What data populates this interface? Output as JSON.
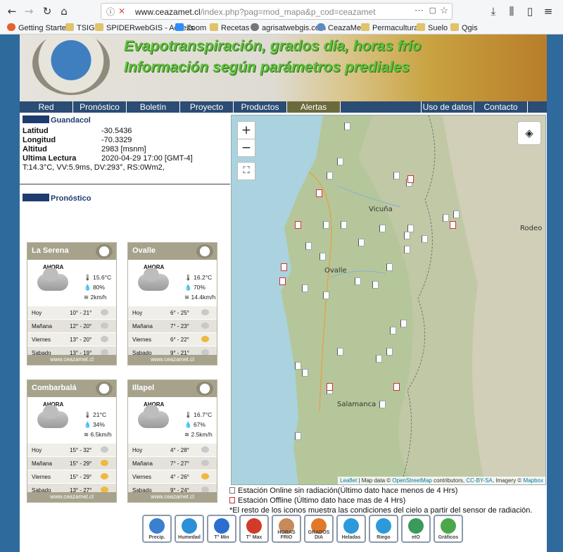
{
  "browser": {
    "url_prefix": "www.ceazamet.cl",
    "url_rest": "/index.php?pag=mod_mapa&p_cod=ceazamet",
    "bookmarks": [
      "Getting Started",
      "TSIG",
      "SPIDERwebGIS - Access",
      "Zoom",
      "Recetas",
      "agrisatwebgis.com",
      "CeazaMet",
      "Permacultura",
      "Suelo",
      "Qgis"
    ]
  },
  "banner": {
    "line1": "Evapotranspiración, grados día, horas frío",
    "line2": "Información según parámetros prediales"
  },
  "menu": [
    "Red",
    "Pronóstico",
    "Boletín",
    "Proyecto",
    "Productos",
    "Alertas",
    "Uso de datos",
    "Contacto"
  ],
  "station": {
    "name": "Guandacol",
    "fields": [
      {
        "k": "Latitud",
        "v": "-30.5436"
      },
      {
        "k": "Longitud",
        "v": "-70.3329"
      },
      {
        "k": "Altitud",
        "v": "2983 [msnm]"
      },
      {
        "k": "Ultima Lectura",
        "v": "2020-04-29 17:00 [GMT-4]"
      }
    ],
    "summary": "T:14.3°C, VV:5.9ms, DV:293°, RS:0Wm2,"
  },
  "forecast": {
    "title": "Pronóstico",
    "now_label": "AHORA",
    "footer": "www.ceazamet.cl",
    "cards": [
      {
        "city": "La Serena",
        "temp": "15.6°C",
        "hum": "80%",
        "wind": "2km/h",
        "days": [
          {
            "d": "Hoy",
            "t": "10° - 21°",
            "w": "pc"
          },
          {
            "d": "Mañana",
            "t": "12° - 20°",
            "w": "pc"
          },
          {
            "d": "Viernes",
            "t": "13° - 20°",
            "w": "c"
          },
          {
            "d": "Sabado",
            "t": "13° - 19°",
            "w": "pc"
          }
        ]
      },
      {
        "city": "Ovalle",
        "temp": "16.2°C",
        "hum": "70%",
        "wind": "14.4km/h",
        "days": [
          {
            "d": "Hoy",
            "t": "6° - 25°",
            "w": "pc"
          },
          {
            "d": "Mañana",
            "t": "7° - 23°",
            "w": "pc"
          },
          {
            "d": "Viernes",
            "t": "6° - 22°",
            "w": "s"
          },
          {
            "d": "Sabado",
            "t": "9° - 21°",
            "w": "pc"
          }
        ]
      },
      {
        "city": "Combarbalá",
        "temp": "21°C",
        "hum": "34%",
        "wind": "6.5km/h",
        "days": [
          {
            "d": "Hoy",
            "t": "15° - 32°",
            "w": "pc"
          },
          {
            "d": "Mañana",
            "t": "15° - 29°",
            "w": "s"
          },
          {
            "d": "Viernes",
            "t": "15° - 29°",
            "w": "s"
          },
          {
            "d": "Sabado",
            "t": "13° - 27°",
            "w": "s"
          }
        ]
      },
      {
        "city": "Illapel",
        "temp": "16.7°C",
        "hum": "67%",
        "wind": "2.5km/h",
        "days": [
          {
            "d": "Hoy",
            "t": "4° - 28°",
            "w": "pc"
          },
          {
            "d": "Mañana",
            "t": "7° - 27°",
            "w": "pc"
          },
          {
            "d": "Viernes",
            "t": "4° - 26°",
            "w": "s"
          },
          {
            "d": "Sabado",
            "t": "9° - 24°",
            "w": "pc"
          }
        ]
      }
    ]
  },
  "map": {
    "zoom_in": "+",
    "zoom_out": "−",
    "places": [
      "Vicuña",
      "Ovalle",
      "Salamanca",
      "Rodeo"
    ],
    "attribution": {
      "leaflet": "Leaflet",
      "mid": " | Map data © ",
      "osm": "OpenStreetMap",
      "contrib": " contributors, ",
      "cc": "CC-BY-SA",
      "imagery": ", Imagery © ",
      "mapbox": "Mapbox"
    }
  },
  "legend": [
    "Estación Online sin radiación(Último dato hace menos de 4 Hrs)",
    "Estación Offline (Último dato hace mas de 4 Hrs)",
    "*El resto de los iconos muestra las condiciones del cielo a partir del sensor de radiación."
  ],
  "tools": [
    "Precip.",
    "Humedad",
    "T° Min",
    "T° Max",
    "HORAS FRIO",
    "GRADOS DIA",
    "Heladas",
    "Riego",
    "etO",
    "Gráficos"
  ]
}
